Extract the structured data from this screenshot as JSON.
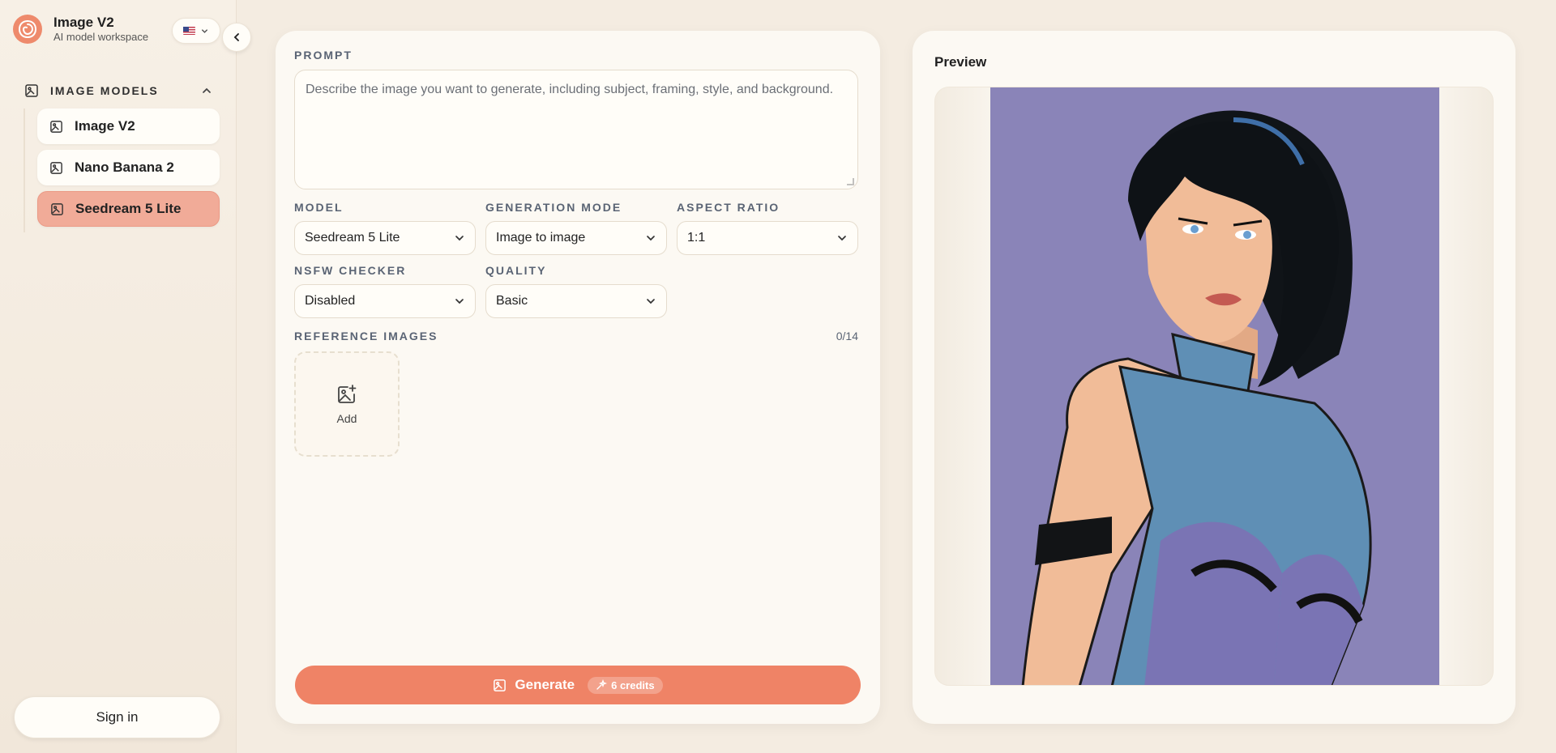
{
  "brand": {
    "title": "Image V2",
    "subtitle": "AI model workspace"
  },
  "sidebar": {
    "section_title": "IMAGE MODELS",
    "items": [
      {
        "label": "Image V2",
        "active": false
      },
      {
        "label": "Nano Banana 2",
        "active": false
      },
      {
        "label": "Seedream 5 Lite",
        "active": true
      }
    ],
    "sign_in": "Sign in"
  },
  "form": {
    "prompt_label": "PROMPT",
    "prompt_placeholder": "Describe the image you want to generate, including subject, framing, style, and background.",
    "model_label": "MODEL",
    "model_value": "Seedream 5 Lite",
    "mode_label": "GENERATION MODE",
    "mode_value": "Image to image",
    "aspect_label": "ASPECT RATIO",
    "aspect_value": "1:1",
    "nsfw_label": "NSFW CHECKER",
    "nsfw_value": "Disabled",
    "quality_label": "QUALITY",
    "quality_value": "Basic",
    "ref_label": "REFERENCE IMAGES",
    "ref_count": "0/14",
    "add_label": "Add",
    "generate_label": "Generate",
    "credits": "6 credits"
  },
  "preview": {
    "title": "Preview"
  },
  "colors": {
    "accent": "#ef8366",
    "active_item": "#f1ab98",
    "background": "#f4ece1",
    "panel": "#fcf9f3"
  },
  "icons": {
    "brand": "spiral-logo",
    "language": "us-flag-icon",
    "collapse": "chevron-left-icon",
    "section": "image-icon",
    "nav": "image-icon",
    "add": "image-plus-icon",
    "generate": "image-icon",
    "credits": "sparkle-icon"
  }
}
